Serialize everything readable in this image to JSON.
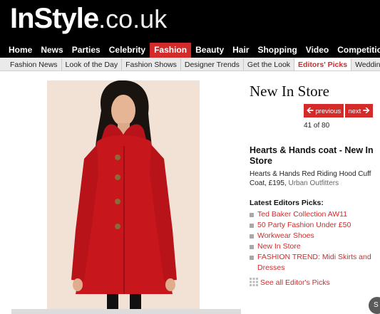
{
  "header": {
    "brand": "InStyle",
    "tld": ".co.uk"
  },
  "main_nav": [
    {
      "label": "Home",
      "active": false
    },
    {
      "label": "News",
      "active": false
    },
    {
      "label": "Parties",
      "active": false
    },
    {
      "label": "Celebrity",
      "active": false
    },
    {
      "label": "Fashion",
      "active": true
    },
    {
      "label": "Beauty",
      "active": false
    },
    {
      "label": "Hair",
      "active": false
    },
    {
      "label": "Shopping",
      "active": false
    },
    {
      "label": "Video",
      "active": false
    },
    {
      "label": "Competitio",
      "active": false
    }
  ],
  "sub_nav": [
    {
      "label": "Fashion News",
      "active": false
    },
    {
      "label": "Look of the Day",
      "active": false
    },
    {
      "label": "Fashion Shows",
      "active": false
    },
    {
      "label": "Designer Trends",
      "active": false
    },
    {
      "label": "Get the Look",
      "active": false
    },
    {
      "label": "Editors' Picks",
      "active": true
    },
    {
      "label": "Wedding",
      "active": false
    }
  ],
  "content": {
    "page_title": "New In Store",
    "pager": {
      "previous_label": "previous",
      "next_label": "next",
      "counter": "41 of 80"
    },
    "product": {
      "title": "Hearts & Hands coat - New In Store",
      "description": "Hearts & Hands Red Riding Hood Cuff Coat, £195,",
      "retailer": "Urban Outfitters"
    },
    "picks": {
      "heading": "Latest Editors Picks:",
      "items": [
        "Ted Baker Collection AW11",
        "50 Party Fashion Under £50",
        "Workwear Shoes",
        "New In Store",
        "FASHION TREND: Midi Skirts and Dresses"
      ],
      "see_all": "See all Editor's Picks"
    },
    "corner_badge": "S"
  },
  "colors": {
    "accent": "#d32a2a",
    "header_bg": "#000000",
    "subnav_bg": "#eaeaea",
    "photo_bg": "#f3e3d7",
    "coat": "#c8161d"
  },
  "icons": [
    "arrow-left-icon",
    "arrow-right-icon",
    "bullet-icon",
    "grid-icon"
  ]
}
